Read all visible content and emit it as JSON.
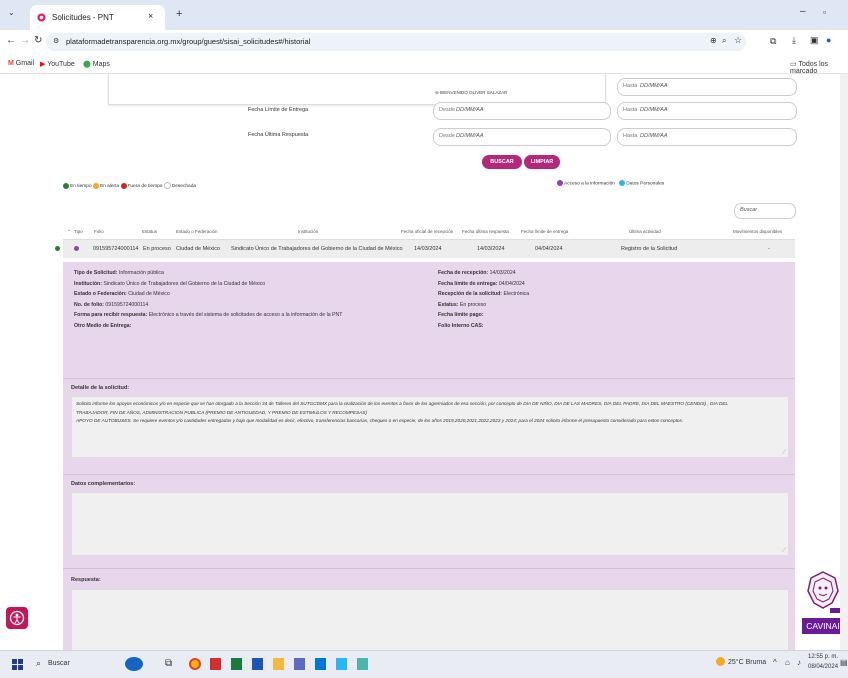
{
  "browser": {
    "tab_title": "Solicitudes - PNT",
    "tab_close": "×",
    "new_tab": "+",
    "url": "plataformadetransparencia.org.mx/group/guest/sisai_solicitudes#/historial",
    "bookmarks": [
      {
        "label": "Gmail",
        "color": "#ea4335"
      },
      {
        "label": "YouTube",
        "color": "#ff0000"
      },
      {
        "label": "Maps",
        "color": "#34a853"
      }
    ],
    "all_bookmarks": "Todos los marcado"
  },
  "header": {
    "welcome": "BIENVENIDO OLIVER SALAZAR",
    "hasta_label": "Hasta",
    "placeholder": "DD/MM/AA"
  },
  "filters": {
    "entrega_label": "Fecha Límite de Entrega",
    "respuesta_label": "Fecha Última Respuesta",
    "desde": "Desde",
    "hasta": "Hasta",
    "placeholder": "DD/MM/AA",
    "buscar": "BUSCAR",
    "limpiar": "LIMPIAR"
  },
  "legend": {
    "left": [
      {
        "label": "En tiempo",
        "color": "#2e7d32"
      },
      {
        "label": "En alerta",
        "color": "#f9a825"
      },
      {
        "label": "Fuera de tiempo",
        "color": "#c62828"
      },
      {
        "label": "Desechada",
        "color": "#cccccc"
      }
    ],
    "right": [
      {
        "label": "Acceso a la información",
        "color": "#8e44ad"
      },
      {
        "label": "Datos Personales",
        "color": "#29b6f6"
      }
    ]
  },
  "table": {
    "search_placeholder": "Buscar",
    "headers": [
      "Tipo",
      "Folio",
      "Estatus",
      "Estado o Federación",
      "Institución",
      "Fecha oficial de recepción",
      "Fecha última respuesta",
      "Fecha límite de entrega",
      "Última actividad",
      "Movimientos disponibles"
    ],
    "row": {
      "folio": "091595724000114",
      "estatus": "En proceso",
      "estado": "Ciudad de México",
      "institucion": "Sindicato Único de Trabajadores del Gobierno de la Ciudad de México",
      "recepcion": "14/03/2024",
      "ultima_respuesta": "14/03/2024",
      "limite": "04/04/2024",
      "actividad": "Registro de la Solicitud",
      "movimientos": "-"
    }
  },
  "details": {
    "left": [
      {
        "label": "Tipo de Solicitud:",
        "value": "Información pública"
      },
      {
        "label": "Institución:",
        "value": "Sindicato Único de Trabajadores del Gobierno de la Ciudad de México"
      },
      {
        "label": "Estado o Federación:",
        "value": "Ciudad de México"
      },
      {
        "label": "No. de folio:",
        "value": "091595724000114"
      },
      {
        "label": "Forma para recibir respuesta:",
        "value": "Electrónico a través del sistema de solicitudes de acceso a la información de la PNT"
      },
      {
        "label": "Otro Medio de Entrega:",
        "value": ""
      }
    ],
    "right": [
      {
        "label": "Fecha de recepción:",
        "value": "14/03/2024"
      },
      {
        "label": "Fecha límite de entrega:",
        "value": "04/04/2024"
      },
      {
        "label": "Recepción de la solicitud:",
        "value": "Electrónica"
      },
      {
        "label": "Estatus:",
        "value": "En proceso"
      },
      {
        "label": "Fecha límite pago:",
        "value": ""
      },
      {
        "label": "Folio Interno CAS:",
        "value": ""
      }
    ],
    "detalle_label": "Detalle de la solicitud:",
    "detalle_text_1": "Solicito informe los apoyos económicos y/o en especie que se han otorgado a la Sección 34 de Talleres del SUTGCDMX para la realización de los eventos a favor de los agremiados de esa sección, por concepto de DIA DE NIÑO, DIA DE LAS MADRES, DIA DEL PADRE, DIA DEL MAESTRO (CENDIS) , DIA DEL",
    "detalle_text_2": "TRABAJADOR, FIN DE AÑOS, ADMINISTRACION PUBLICA (PREMIO DE ANTIGUEDAD, Y PREMIO DE ESTIMULOS Y RECOMPESAS)",
    "detalle_text_3": "APOYO DE AUTOBUSES. Se requiere eventos y/o cantidades entregadas y bajo que modalidad es decir, efectivo, transferencias bancarias, cheques o en especie, de los años 2019,2020,2021,2022,2023 y 2024; para el 2024 solicito informe el presupuesto considerado para estos conceptos.",
    "complementarios_label": "Datos complementarios:",
    "respuesta_label": "Respuesta:"
  },
  "widgets": {
    "cavinai": "CAVINAI"
  },
  "taskbar": {
    "search": "Buscar",
    "weather": "25°C Bruma",
    "time": "12:55 p. m.",
    "date": "08/04/2024"
  }
}
